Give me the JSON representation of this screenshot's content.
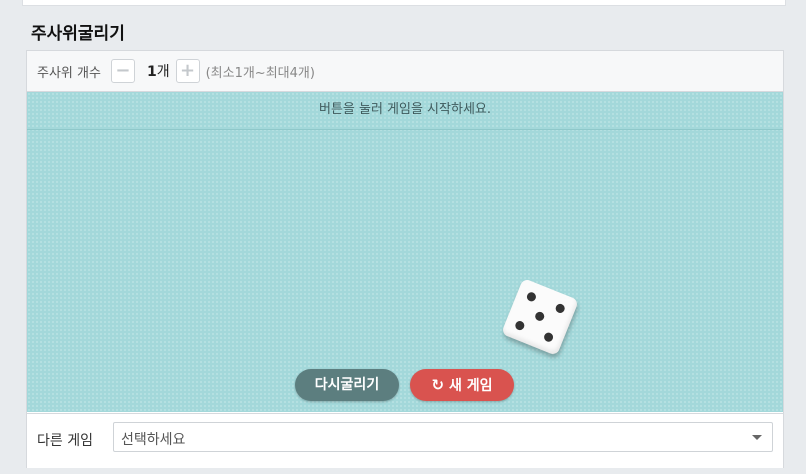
{
  "page": {
    "title": "주사위굴리기"
  },
  "counter": {
    "label": "주사위 개수",
    "minus_symbol": "−",
    "plus_symbol": "+",
    "count_number": "1",
    "count_unit": "개",
    "range_text": "(최소1개~최대4개)"
  },
  "board": {
    "instruction": "버튼을 눌러 게임을 시작하세요.",
    "die_face": 5,
    "colors": {
      "board": "#a3d8da",
      "reroll": "#5c7e7f",
      "new_game": "#d9534f"
    }
  },
  "buttons": {
    "reroll_label": "다시굴리기",
    "new_game_label": "새 게임",
    "new_game_icon": "refresh-icon"
  },
  "footer": {
    "label": "다른 게임",
    "select_value": "선택하세요"
  }
}
